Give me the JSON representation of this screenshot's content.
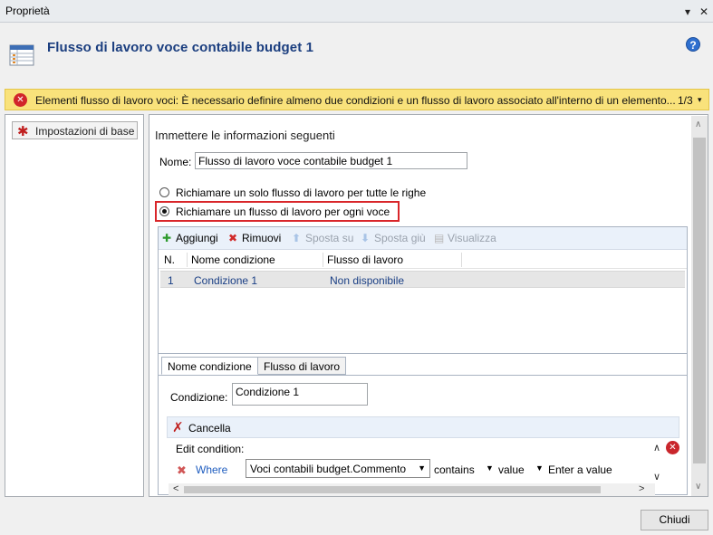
{
  "window": {
    "title": "Proprietà",
    "chevron_glyph": "▾",
    "close_glyph": "✕"
  },
  "header": {
    "title": "Flusso di lavoro voce contabile budget 1",
    "icon": "workflow-table-icon",
    "help_glyph": "?"
  },
  "error_bar": {
    "icon_glyph": "✕",
    "message": "Elementi flusso di lavoro voci: È necessario definire almeno due condizioni e un flusso di lavoro associato all'interno di un elemento...",
    "counter": "1/3",
    "chevron_glyph": "▾"
  },
  "sidebar": {
    "items": [
      {
        "label": "Impostazioni di base",
        "icon_glyph": "✱"
      }
    ]
  },
  "form": {
    "intro": "Immettere le informazioni seguenti",
    "name_label": "Nome:",
    "name_value": "Flusso di lavoro voce contabile budget 1",
    "radio_single_label": "Richiamare un solo flusso di lavoro per tutte le righe",
    "radio_each_label": "Richiamare un flusso di lavoro per ogni voce",
    "selected_radio": "each"
  },
  "toolbar": {
    "add_label": "Aggiungi",
    "remove_label": "Rimuovi",
    "move_up_label": "Sposta su",
    "move_down_label": "Sposta giù",
    "view_label": "Visualizza",
    "add_glyph": "✚",
    "remove_glyph": "✖",
    "up_glyph": "⬆",
    "down_glyph": "⬇",
    "view_glyph": "▤"
  },
  "grid": {
    "columns": [
      "N.",
      "Nome condizione",
      "Flusso di lavoro"
    ],
    "rows": [
      {
        "n": "1",
        "condition": "Condizione 1",
        "workflow": "Non disponibile"
      }
    ]
  },
  "tabs": [
    {
      "label": "Nome condizione",
      "active": true
    },
    {
      "label": "Flusso di lavoro",
      "active": false
    }
  ],
  "condition": {
    "label": "Condizione:",
    "value": "Condizione 1",
    "cancel_label": "Cancella",
    "cancel_glyph": "✗",
    "edit_label": "Edit condition:",
    "where_label": "Where",
    "where_glyph": "✖",
    "field": "Voci contabili budget.Commento",
    "operator": "contains",
    "value_type": "value",
    "value_placeholder": "Enter a value",
    "dropdown_glyph": "▼",
    "delete_glyph": "✕"
  },
  "scroll": {
    "up": "∧",
    "down": "∨",
    "left": "<",
    "right": ">"
  },
  "footer": {
    "close_label": "Chiudi"
  },
  "colors": {
    "title_blue": "#1b3e7f",
    "error_bg": "#f9e27b",
    "highlight_red": "#d9262a",
    "link_blue": "#1e5cbf"
  }
}
